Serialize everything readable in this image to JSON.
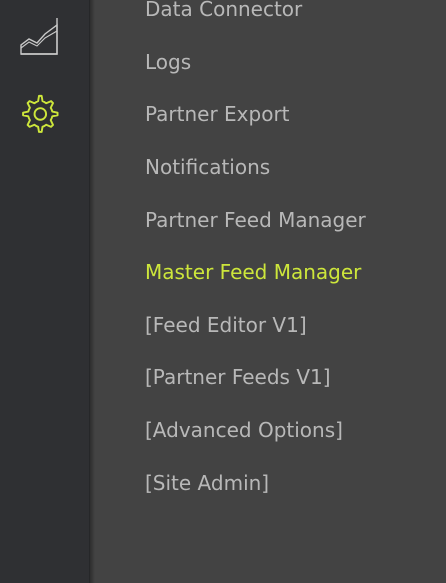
{
  "theme": {
    "rail_background": "#2f3033",
    "panel_background": "#434343",
    "text_color": "#b8b8b8",
    "accent": "#cde63b",
    "icon_default": "#c9c9c9"
  },
  "rail": {
    "items": [
      {
        "icon": "area-chart-icon",
        "active": false
      },
      {
        "icon": "gear-icon",
        "active": true
      }
    ]
  },
  "menu": {
    "items": [
      {
        "label": "Data Connector",
        "active": false
      },
      {
        "label": "Logs",
        "active": false
      },
      {
        "label": "Partner Export",
        "active": false
      },
      {
        "label": "Notifications",
        "active": false
      },
      {
        "label": "Partner Feed Manager",
        "active": false
      },
      {
        "label": "Master Feed Manager",
        "active": true
      },
      {
        "label": "[Feed Editor V1]",
        "active": false
      },
      {
        "label": "[Partner Feeds V1]",
        "active": false
      },
      {
        "label": "[Advanced Options]",
        "active": false
      },
      {
        "label": "[Site Admin]",
        "active": false
      }
    ]
  }
}
